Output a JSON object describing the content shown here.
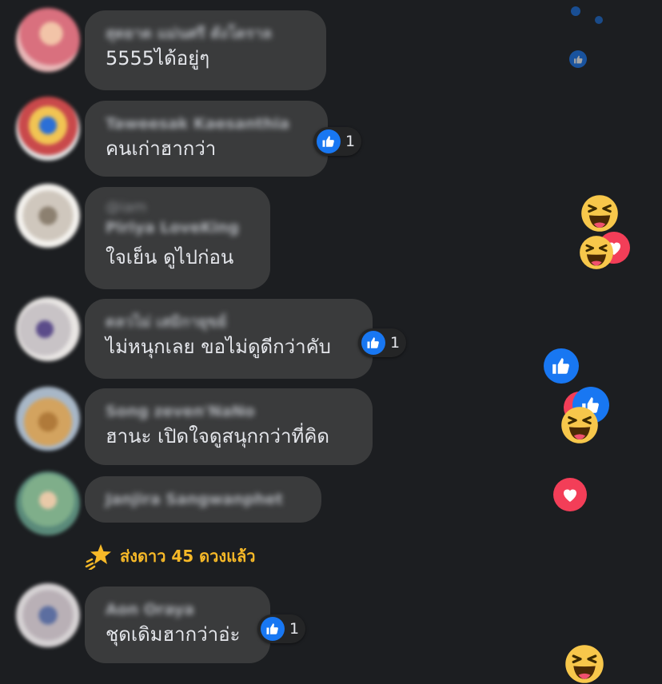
{
  "comments": [
    {
      "name": "สุดยาด แม่นศรี ดังโดราล",
      "handle": "",
      "text": "5555ได้อยู่ๆ",
      "likes": ""
    },
    {
      "name": "Taweesak Kaesanthia",
      "handle": "",
      "text": "คนเก่าฮากว่า",
      "likes": "1"
    },
    {
      "name": "Piriya LoveKing",
      "handle": "@iam",
      "text": "ใจเย็น ดูไปก่อน",
      "likes": ""
    },
    {
      "name": "ดลวไม่ เสมิกายุขย์",
      "handle": "",
      "text": "ไม่หนุกเลย ขอไม่ดูดีกว่าคับ",
      "likes": "1"
    },
    {
      "name": "Song zeven'NaNo",
      "handle": "",
      "text": "ฮานะ เปิดใจดูสนุกกว่าที่คิด",
      "likes": ""
    },
    {
      "name": "Janjira Sangwanphet",
      "handle": "",
      "text": "",
      "likes": ""
    },
    {
      "name": "Aon Oraya",
      "handle": "",
      "text": "ชุดเดิมฮากว่าอ่ะ",
      "likes": "1"
    }
  ],
  "stars_event": {
    "text": "ส่งดาว 45 ดวงแล้ว"
  },
  "floating_reactions": [
    "like",
    "like",
    "like",
    "haha",
    "love",
    "haha",
    "like",
    "like",
    "haha",
    "love",
    "haha"
  ],
  "colors": {
    "like": "#1877f2",
    "love": "#f33e58",
    "haha": "#f7c74b",
    "star": "#f7b928",
    "bubble": "#3a3b3c",
    "background": "#1c1e21"
  }
}
